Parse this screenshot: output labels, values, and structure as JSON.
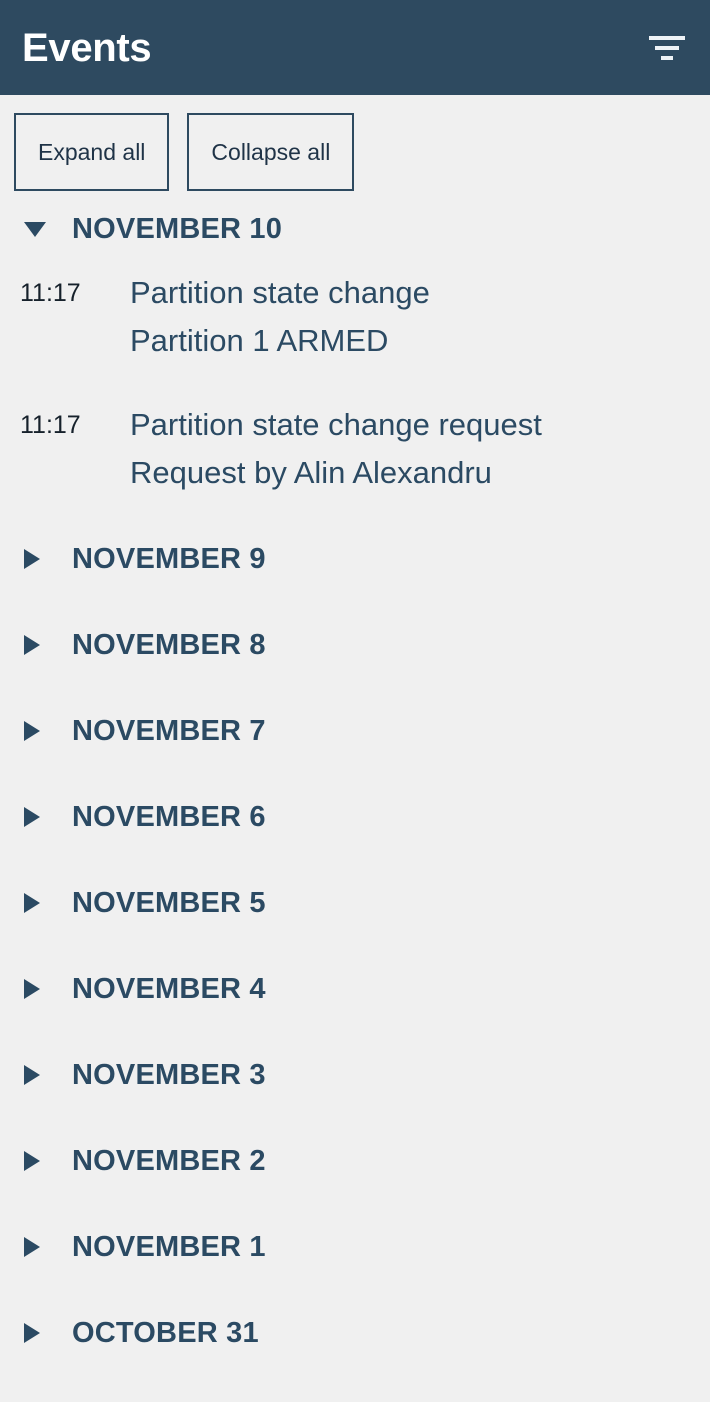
{
  "header": {
    "title": "Events",
    "filter_icon": "filter-icon",
    "background_color": "#2e4a60",
    "title_color": "#ffffff"
  },
  "toolbar": {
    "expand_all_label": "Expand all",
    "collapse_all_label": "Collapse all",
    "border_color": "#2e4a60"
  },
  "theme": {
    "page_background": "#f0f0f0",
    "accent": "#2b4a63",
    "time_text": "#16212b"
  },
  "groups": [
    {
      "date_label": "NOVEMBER 10",
      "expanded": true,
      "caret": "triangle-down-icon",
      "events": [
        {
          "time": "11:17",
          "title": "Partition state change",
          "detail": "Partition 1 ARMED"
        },
        {
          "time": "11:17",
          "title": "Partition state change request",
          "detail": "Request by Alin Alexandru"
        }
      ]
    },
    {
      "date_label": "NOVEMBER 9",
      "expanded": false,
      "caret": "triangle-right-icon",
      "events": []
    },
    {
      "date_label": "NOVEMBER 8",
      "expanded": false,
      "caret": "triangle-right-icon",
      "events": []
    },
    {
      "date_label": "NOVEMBER 7",
      "expanded": false,
      "caret": "triangle-right-icon",
      "events": []
    },
    {
      "date_label": "NOVEMBER 6",
      "expanded": false,
      "caret": "triangle-right-icon",
      "events": []
    },
    {
      "date_label": "NOVEMBER 5",
      "expanded": false,
      "caret": "triangle-right-icon",
      "events": []
    },
    {
      "date_label": "NOVEMBER 4",
      "expanded": false,
      "caret": "triangle-right-icon",
      "events": []
    },
    {
      "date_label": "NOVEMBER 3",
      "expanded": false,
      "caret": "triangle-right-icon",
      "events": []
    },
    {
      "date_label": "NOVEMBER 2",
      "expanded": false,
      "caret": "triangle-right-icon",
      "events": []
    },
    {
      "date_label": "NOVEMBER 1",
      "expanded": false,
      "caret": "triangle-right-icon",
      "events": []
    },
    {
      "date_label": "OCTOBER 31",
      "expanded": false,
      "caret": "triangle-right-icon",
      "events": []
    }
  ]
}
